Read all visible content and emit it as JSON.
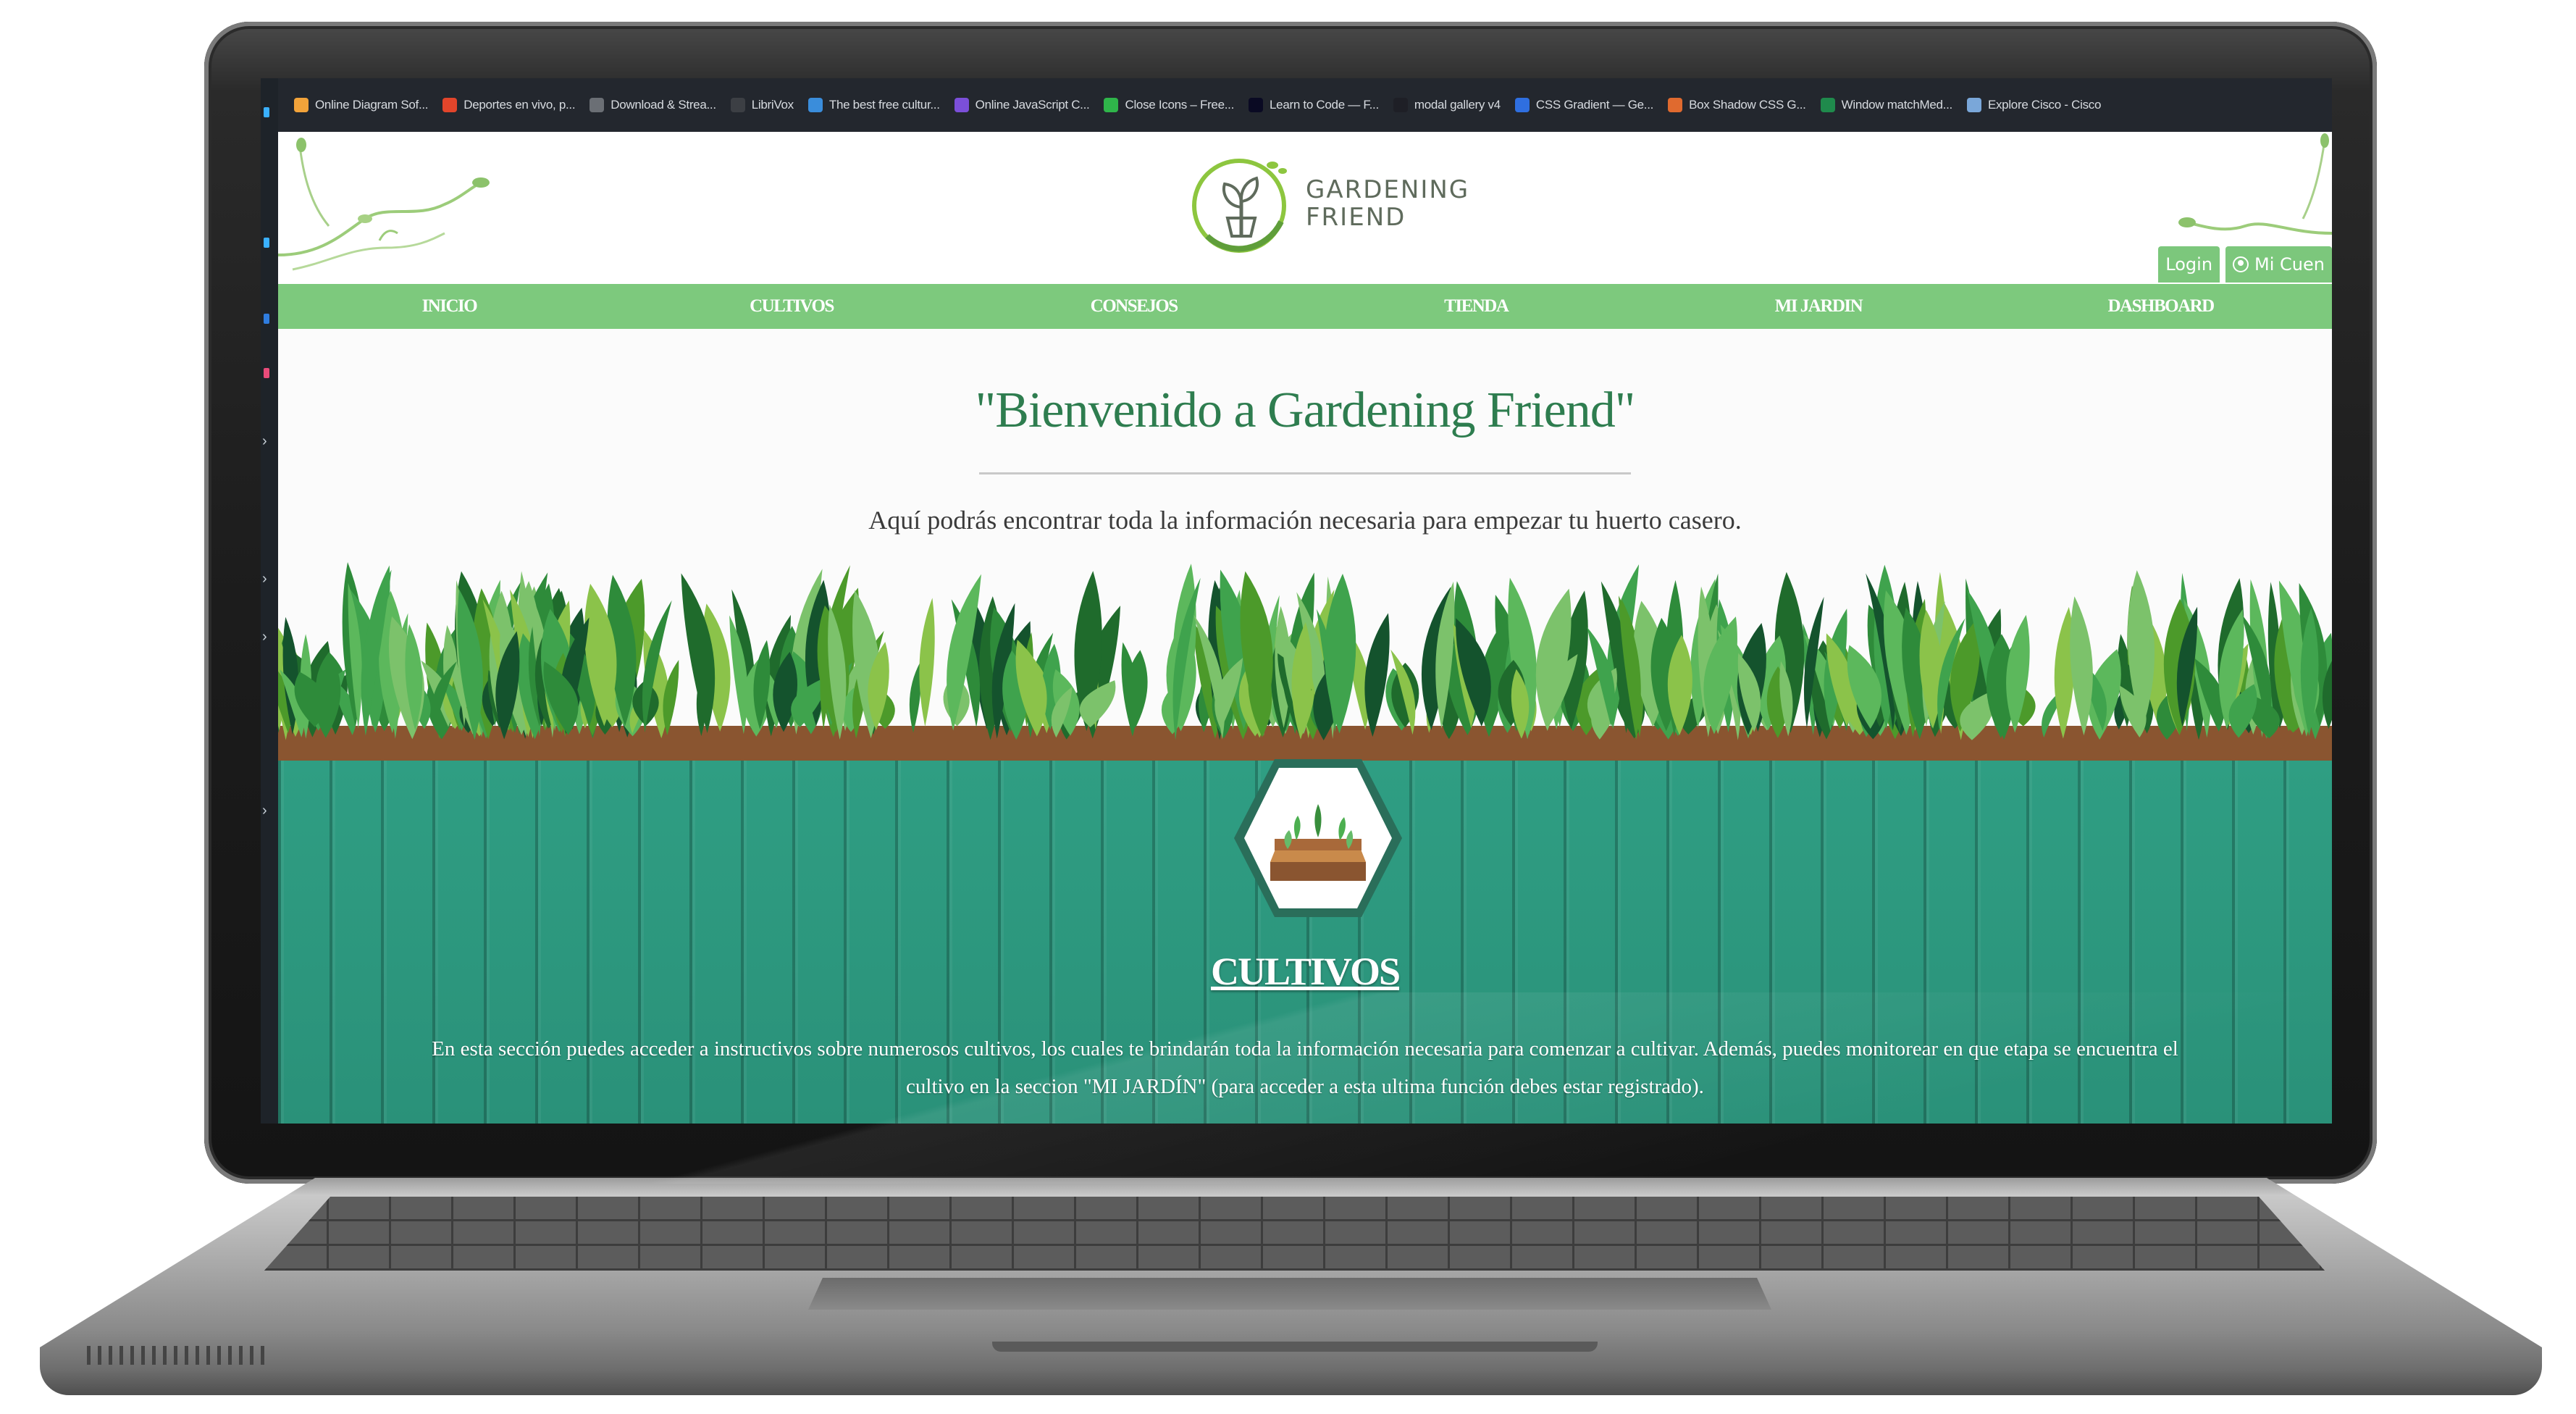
{
  "bookmarks": [
    {
      "label": "Online Diagram Sof...",
      "icon": "diagram-icon",
      "color": "#f2a33a"
    },
    {
      "label": "Deportes en vivo, p...",
      "icon": "star-icon",
      "color": "#e2452b"
    },
    {
      "label": "Download & Strea...",
      "icon": "page-icon",
      "color": "#6b6f75"
    },
    {
      "label": "LibriVox",
      "icon": "book-icon",
      "color": "#3c3f44"
    },
    {
      "label": "The best free cultur...",
      "icon": "culture-icon",
      "color": "#3a8ddb"
    },
    {
      "label": "Online JavaScript C...",
      "icon": "js-icon",
      "color": "#7b4fd9"
    },
    {
      "label": "Close Icons – Free...",
      "icon": "icons-site-icon",
      "color": "#2fb54a"
    },
    {
      "label": "Learn to Code — F...",
      "icon": "code-icon",
      "color": "#0a0a23"
    },
    {
      "label": "modal gallery v4",
      "icon": "codepen-icon",
      "color": "#1e1f26"
    },
    {
      "label": "CSS Gradient — Ge...",
      "icon": "gradient-icon",
      "color": "#2f6fe0"
    },
    {
      "label": "Box Shadow CSS G...",
      "icon": "shadow-icon",
      "color": "#e06a2f"
    },
    {
      "label": "Window matchMed...",
      "icon": "mdn-icon",
      "color": "#1f8a4c"
    },
    {
      "label": "Explore Cisco - Cisco",
      "icon": "cisco-icon",
      "color": "#7aa7d9"
    }
  ],
  "header": {
    "logo_line1": "GARDENING",
    "logo_line2": "FRIEND",
    "login_label": "Login",
    "account_label": "Mi Cuen"
  },
  "nav": [
    "INICIO",
    "CULTIVOS",
    "CONSEJOS",
    "TIENDA",
    "MI JARDIN",
    "DASHBOARD"
  ],
  "welcome": {
    "title": "\"Bienvenido a Gardening Friend\"",
    "subtitle": "Aquí podrás encontrar toda la información necesaria para empezar tu huerto casero."
  },
  "cultivos": {
    "title": "CULTIVOS",
    "text": "En esta sección puedes acceder a instructivos sobre numerosos cultivos, los cuales te brindarán toda la información necesaria para comenzar a cultivar. Además, puedes monitorear en que etapa se encuentra el cultivo en la seccion \"MI JARDÍN\" (para acceder a esta ultima función debes estar registrado)."
  },
  "colors": {
    "nav_green": "#7dc97d",
    "title_green": "#2e7d4f",
    "fence_teal": "#2f9e83",
    "soil_brown": "#8a5530"
  }
}
